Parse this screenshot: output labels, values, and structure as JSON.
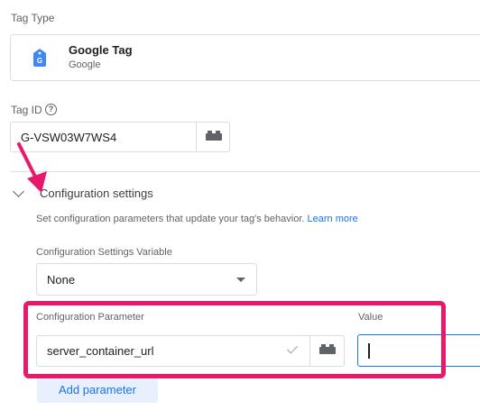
{
  "tag_type": {
    "label": "Tag Type",
    "name": "Google Tag",
    "vendor": "Google",
    "icon": "google-tag-icon",
    "icon_color": "#4285f4"
  },
  "tag_id": {
    "label": "Tag ID",
    "help_icon": "help-icon",
    "value": "G-VSW03W7WS4",
    "variable_icon": "variable-brick-icon"
  },
  "config": {
    "title": "Configuration settings",
    "description": "Set configuration parameters that update your tag's behavior.",
    "learn_more": "Learn more",
    "variable_label": "Configuration Settings Variable",
    "variable_value": "None"
  },
  "parameters": {
    "param_label": "Configuration Parameter",
    "value_label": "Value",
    "param_value": "server_container_url",
    "value_value": "",
    "add_button": "Add parameter"
  },
  "annotation": {
    "color": "#e8196b",
    "highlight": "highlight-box",
    "arrow": "pointer-arrow"
  },
  "colors": {
    "accent": "#1a73e8",
    "accent_bg": "#e8f0fe",
    "border": "#dadce0",
    "muted_text": "#5f6368"
  }
}
